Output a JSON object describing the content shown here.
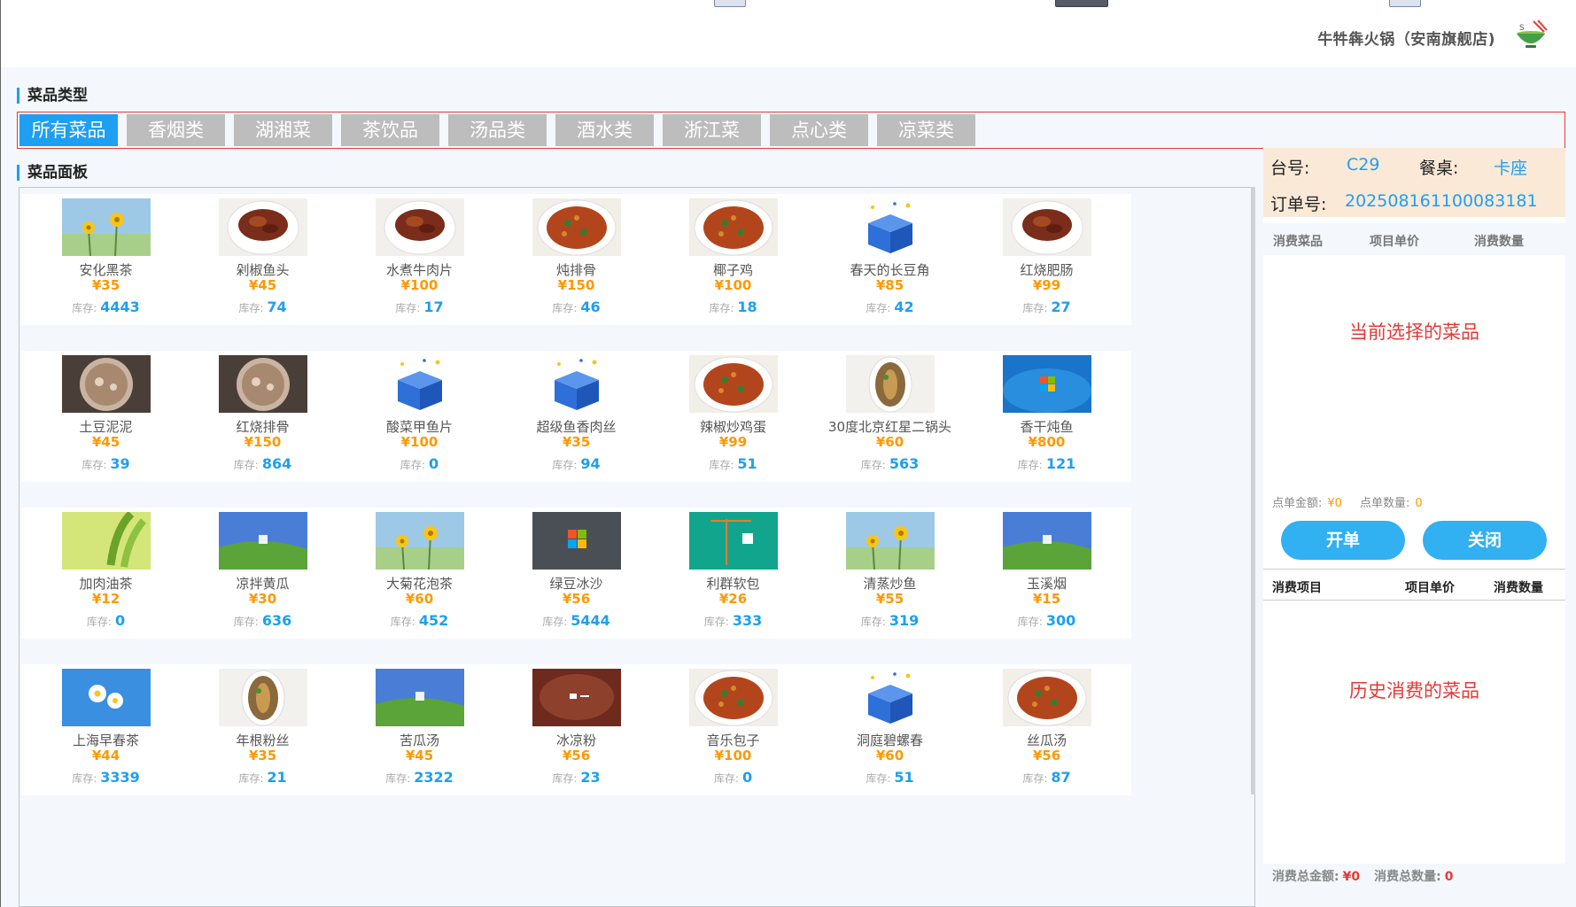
{
  "header": {
    "store_name": "牛牪犇火锅（安南旗舰店)",
    "logo_icon": "bowl-chopsticks-icon"
  },
  "sections": {
    "category_title": "菜品类型",
    "panel_title": "菜品面板"
  },
  "categories": [
    {
      "label": "所有菜品",
      "active": true
    },
    {
      "label": "香烟类",
      "active": false
    },
    {
      "label": "湖湘菜",
      "active": false
    },
    {
      "label": "茶饮品",
      "active": false
    },
    {
      "label": "汤品类",
      "active": false
    },
    {
      "label": "酒水类",
      "active": false
    },
    {
      "label": "浙江菜",
      "active": false
    },
    {
      "label": "点心类",
      "active": false
    },
    {
      "label": "凉菜类",
      "active": false
    }
  ],
  "stock_label": "库存:",
  "dishes": [
    {
      "name": "安化黑茶",
      "price": "¥35",
      "stock": "4443",
      "image": "yellow-flowers"
    },
    {
      "name": "剁椒鱼头",
      "price": "¥45",
      "stock": "74",
      "image": "braised-plate"
    },
    {
      "name": "水煮牛肉片",
      "price": "¥100",
      "stock": "17",
      "image": "braised-plate"
    },
    {
      "name": "炖排骨",
      "price": "¥150",
      "stock": "46",
      "image": "stir-fry-plate"
    },
    {
      "name": "椰子鸡",
      "price": "¥100",
      "stock": "18",
      "image": "stir-fry-plate"
    },
    {
      "name": "春天的长豆角",
      "price": "¥85",
      "stock": "42",
      "image": "blue-box"
    },
    {
      "name": "红烧肥肠",
      "price": "¥99",
      "stock": "27",
      "image": "braised-plate"
    },
    {
      "name": "土豆泥泥",
      "price": "¥45",
      "stock": "39",
      "image": "soup-bowl"
    },
    {
      "name": "红烧排骨",
      "price": "¥150",
      "stock": "864",
      "image": "soup-bowl"
    },
    {
      "name": "酸菜甲鱼片",
      "price": "¥100",
      "stock": "0",
      "image": "blue-box"
    },
    {
      "name": "超级鱼香肉丝",
      "price": "¥35",
      "stock": "94",
      "image": "blue-box"
    },
    {
      "name": "辣椒炒鸡蛋",
      "price": "¥99",
      "stock": "51",
      "image": "stir-fry-plate"
    },
    {
      "name": "30度北京红星二锅头",
      "price": "¥60",
      "stock": "563",
      "image": "fish-plate"
    },
    {
      "name": "香干炖鱼",
      "price": "¥800",
      "stock": "121",
      "image": "win7-desktop"
    },
    {
      "name": "加肉油茶",
      "price": "¥12",
      "stock": "0",
      "image": "green-leaves"
    },
    {
      "name": "凉拌黄瓜",
      "price": "¥30",
      "stock": "636",
      "image": "green-hill"
    },
    {
      "name": "大菊花泡茶",
      "price": "¥60",
      "stock": "452",
      "image": "yellow-flowers"
    },
    {
      "name": "绿豆冰沙",
      "price": "¥56",
      "stock": "5444",
      "image": "windows-logo-gray"
    },
    {
      "name": "利群软包",
      "price": "¥26",
      "stock": "333",
      "image": "teal-crane"
    },
    {
      "name": "清蒸炒鱼",
      "price": "¥55",
      "stock": "319",
      "image": "yellow-flowers"
    },
    {
      "name": "玉溪烟",
      "price": "¥15",
      "stock": "300",
      "image": "green-hill"
    },
    {
      "name": "上海早春茶",
      "price": "¥44",
      "stock": "3339",
      "image": "daisies"
    },
    {
      "name": "年根粉丝",
      "price": "¥35",
      "stock": "21",
      "image": "fish-plate"
    },
    {
      "name": "苦瓜汤",
      "price": "¥45",
      "stock": "2322",
      "image": "green-hill"
    },
    {
      "name": "冰凉粉",
      "price": "¥56",
      "stock": "23",
      "image": "dark-red-wall"
    },
    {
      "name": "音乐包子",
      "price": "¥100",
      "stock": "0",
      "image": "stir-fry-plate"
    },
    {
      "name": "洞庭碧螺春",
      "price": "¥60",
      "stock": "51",
      "image": "blue-box"
    },
    {
      "name": "丝瓜汤",
      "price": "¥56",
      "stock": "87",
      "image": "stir-fry-plate"
    }
  ],
  "order": {
    "table_no_label": "台号:",
    "table_no": "C29",
    "seat_label": "餐桌:",
    "seat": "卡座",
    "order_no_label": "订单号:",
    "order_no": "202508161100083181"
  },
  "current_table": {
    "col_item": "消费菜品",
    "col_price": "项目单价",
    "col_qty": "消费数量",
    "hint": "当前选择的菜品",
    "amount_label": "点单金额:",
    "amount": "¥0",
    "count_label": "点单数量:",
    "count": "0"
  },
  "buttons": {
    "open": "开单",
    "close": "关闭"
  },
  "history_table": {
    "col_item": "消费项目",
    "col_price": "项目单价",
    "col_qty": "消费数量",
    "hint": "历史消费的菜品",
    "total_amount_label": "消费总金额:",
    "total_amount": "¥0",
    "total_count_label": "消费总数量:",
    "total_count": "0"
  },
  "colors": {
    "accent": "#1e9ff2",
    "price": "#ff9800",
    "alert": "#e53935",
    "tab_inactive": "#bdbdbd",
    "order_info_bg": "#fbe9d8"
  }
}
